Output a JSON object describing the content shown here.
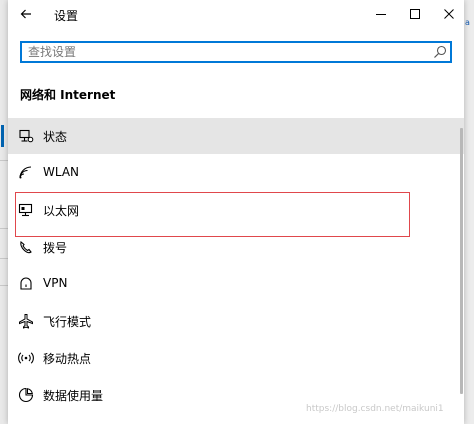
{
  "window": {
    "title": "设置",
    "controls": {
      "minimize": "minimize-icon",
      "maximize": "maximize-icon",
      "close": "close-icon"
    }
  },
  "search": {
    "placeholder": "查找设置",
    "value": "",
    "icon": "search-icon"
  },
  "section": {
    "title": "网络和 Internet"
  },
  "nav": {
    "items": [
      {
        "label": "状态",
        "icon": "status-icon",
        "selected": true
      },
      {
        "label": "WLAN",
        "icon": "wifi-icon",
        "selected": false
      },
      {
        "label": "以太网",
        "icon": "ethernet-icon",
        "selected": false
      },
      {
        "label": "拨号",
        "icon": "dialup-icon",
        "selected": false
      },
      {
        "label": "VPN",
        "icon": "vpn-icon",
        "selected": false
      },
      {
        "label": "飞行模式",
        "icon": "airplane-icon",
        "selected": false
      },
      {
        "label": "移动热点",
        "icon": "hotspot-icon",
        "selected": false
      },
      {
        "label": "数据使用量",
        "icon": "data-usage-icon",
        "selected": false
      }
    ]
  },
  "background": {
    "right_tag": "a"
  },
  "watermark": {
    "text": "https://blog.csdn.net/maikuni1"
  },
  "colors": {
    "accent": "#0078d7",
    "highlight_box": "#e0474c",
    "selected_bg": "#e5e5e5"
  }
}
